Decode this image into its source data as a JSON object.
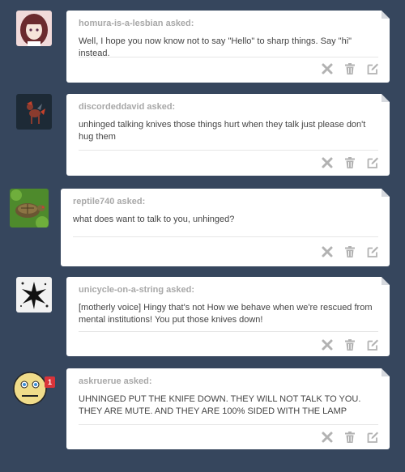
{
  "posts": [
    {
      "asker": "homura-is-a-lesbian asked:",
      "question": "Well, I hope you now know not to say \"Hello\" to sharp things. Say \"hi\" instead.",
      "avatar": "anime-girl-avatar"
    },
    {
      "asker": "discordeddavid asked:",
      "question": "unhinged talking knives those things hurt when they talk just please don't hug them",
      "avatar": "pony-avatar"
    },
    {
      "asker": "reptile740 asked:",
      "question": "what does want to talk to you, unhinged?",
      "avatar": "turtle-avatar"
    },
    {
      "asker": "unicycle-on-a-string asked:",
      "question": "[motherly voice] Hingy that's not How we behave when we're rescued from mental institutions! You put those knives down!",
      "avatar": "star-avatar"
    },
    {
      "asker": "askruerue asked:",
      "question": "UHNINGED PUT THE KNIFE DOWN. THEY WILL NOT TALK TO YOU. THEY ARE MUTE. AND THEY ARE 100% SIDED WITH THE LAMP",
      "avatar": "smiley-avatar",
      "badge": "1"
    }
  ],
  "icons": {
    "delete": "x-icon",
    "trash": "trash-icon",
    "edit": "edit-icon"
  },
  "colors": {
    "background": "#36465d",
    "card": "#ffffff",
    "asker_text": "#a8a8a8",
    "question_text": "#444444",
    "icon": "#b2b2b2",
    "badge": "#d9343a"
  }
}
